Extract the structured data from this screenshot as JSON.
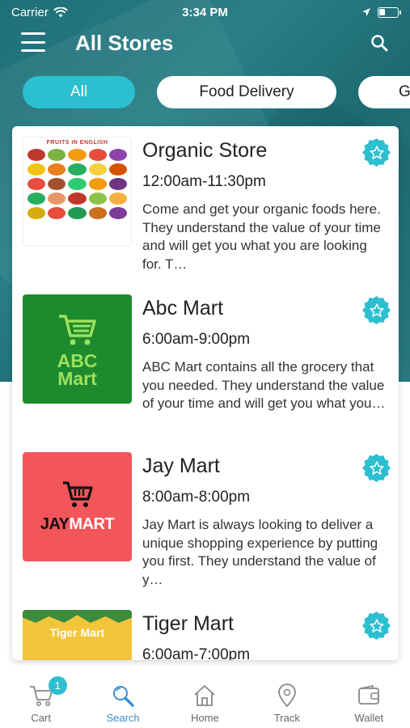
{
  "status_bar": {
    "carrier": "Carrier",
    "time": "3:34 PM"
  },
  "header": {
    "title": "All Stores"
  },
  "filters": [
    {
      "label": "All",
      "active": true
    },
    {
      "label": "Food Delivery",
      "active": false
    },
    {
      "label": "G",
      "active": false
    }
  ],
  "stores": [
    {
      "name": "Organic Store",
      "hours": "12:00am-11:30pm",
      "description": "Come and get your organic foods here. They understand the value of your time and will get you what you are looking for. T…",
      "thumb_title": "FRUITS IN ENGLISH"
    },
    {
      "name": "Abc Mart",
      "hours": "6:00am-9:00pm",
      "description": "ABC Mart contains all the grocery that you needed. They understand the value of your time and will get you what you…",
      "logo_line1": "ABC",
      "logo_line2": "Mart"
    },
    {
      "name": "Jay Mart",
      "hours": "8:00am-8:00pm",
      "description": "Jay Mart is always looking to deliver a unique shopping experience by putting you first. They understand the value of y…",
      "logo_part1": "JAY",
      "logo_part2": "MART"
    },
    {
      "name": "Tiger Mart",
      "hours": "6:00am-7:00pm",
      "description": "",
      "logo_text": "Tiger Mart"
    }
  ],
  "tab_bar": {
    "cart_badge": "1",
    "items": [
      {
        "label": "Cart",
        "icon": "cart-icon"
      },
      {
        "label": "Search",
        "icon": "search-icon"
      },
      {
        "label": "Home",
        "icon": "home-icon"
      },
      {
        "label": "Track",
        "icon": "location-pin-icon"
      },
      {
        "label": "Wallet",
        "icon": "wallet-icon"
      }
    ]
  },
  "colors": {
    "accent": "#2cbfcf",
    "header_bg": "#1f6f78",
    "active_tab": "#3a8fd6"
  }
}
